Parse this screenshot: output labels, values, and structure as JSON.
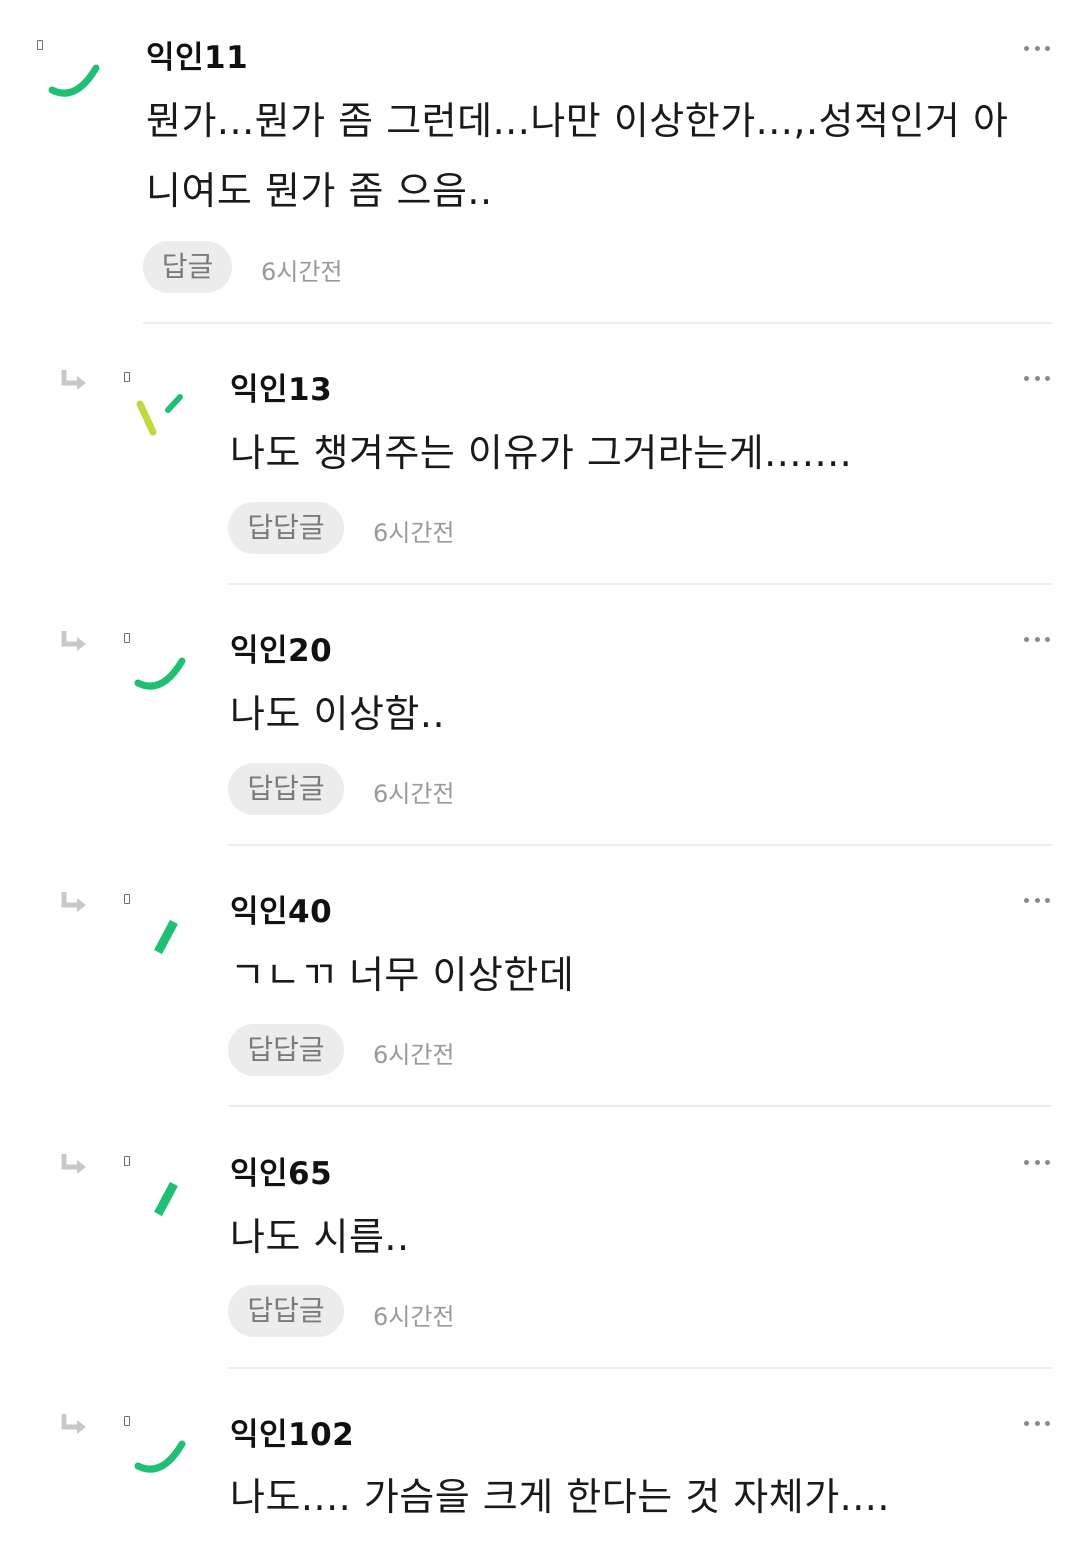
{
  "colors": {
    "avatar_green": "#1fbf74",
    "avatar_lime": "#c3d83a",
    "reply_button_bg": "#ececec",
    "reply_button_text": "#7b7b7b",
    "timestamp": "#9a9a9a",
    "divider": "#ececec"
  },
  "comments": [
    {
      "author": "익인11",
      "body_line1": "뭔가...뭔가 좀 그런데...나만 이상한가...,.성적인거 아",
      "body_line2": "니여도 뭔가 좀 으음..",
      "reply_label": "답글",
      "time": "6시간전",
      "avatar_icon": "green-arc-avatar-icon"
    },
    {
      "author": "익인13",
      "body": "나도 챙겨주는 이유가 그거라는게.......",
      "reply_label": "답답글",
      "time": "6시간전",
      "avatar_icon": "lime-check-avatar-icon"
    },
    {
      "author": "익인20",
      "body": "나도 이상함..",
      "reply_label": "답답글",
      "time": "6시간전",
      "avatar_icon": "green-arc-avatar-icon"
    },
    {
      "author": "익인40",
      "body": "ㄱㄴㄲ 너무 이상한데",
      "reply_label": "답답글",
      "time": "6시간전",
      "avatar_icon": "green-dash-avatar-icon"
    },
    {
      "author": "익인65",
      "body": "나도 시름..",
      "reply_label": "답답글",
      "time": "6시간전",
      "avatar_icon": "green-dash-avatar-icon"
    },
    {
      "author": "익인102",
      "body": "나도.... 가슴을 크게 한다는 것 자체가....",
      "avatar_icon": "green-arc-avatar-icon"
    }
  ]
}
